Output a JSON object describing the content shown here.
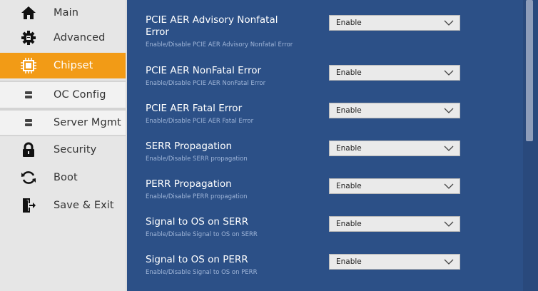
{
  "sidebar": {
    "items": [
      {
        "label": "Main",
        "icon": "home-icon"
      },
      {
        "label": "Advanced",
        "icon": "gear-icon"
      },
      {
        "label": "Chipset",
        "icon": "chip-icon"
      },
      {
        "label": "OC Config",
        "icon": "dot-icon"
      },
      {
        "label": "Server Mgmt",
        "icon": "dot-icon"
      },
      {
        "label": "Security",
        "icon": "lock-icon"
      },
      {
        "label": "Boot",
        "icon": "refresh-icon"
      },
      {
        "label": "Save & Exit",
        "icon": "exit-icon"
      }
    ]
  },
  "settings": [
    {
      "title": "PCIE AER Advisory Nonfatal Error",
      "desc": "Enable/Disable PCIE AER Advisory Nonfatal Error",
      "value": "Enable"
    },
    {
      "title": "PCIE AER NonFatal Error",
      "desc": "Enable/Disable PCIE AER NonFatal Error",
      "value": "Enable"
    },
    {
      "title": "PCIE AER Fatal Error",
      "desc": "Enable/Disable PCIE AER Fatal Error",
      "value": "Enable"
    },
    {
      "title": "SERR Propagation",
      "desc": "Enable/Disable SERR propagation",
      "value": "Enable"
    },
    {
      "title": "PERR Propagation",
      "desc": "Enable/Disable PERR propagation",
      "value": "Enable"
    },
    {
      "title": "Signal to OS on SERR",
      "desc": "Enable/Disable Signal to OS on SERR",
      "value": "Enable"
    },
    {
      "title": "Signal to OS on PERR",
      "desc": "Enable/Disable Signal to OS on PERR",
      "value": "Enable"
    }
  ],
  "colors": {
    "accent": "#f29b16",
    "panel": "#2c5087",
    "sidebar": "#e6e6e6"
  }
}
